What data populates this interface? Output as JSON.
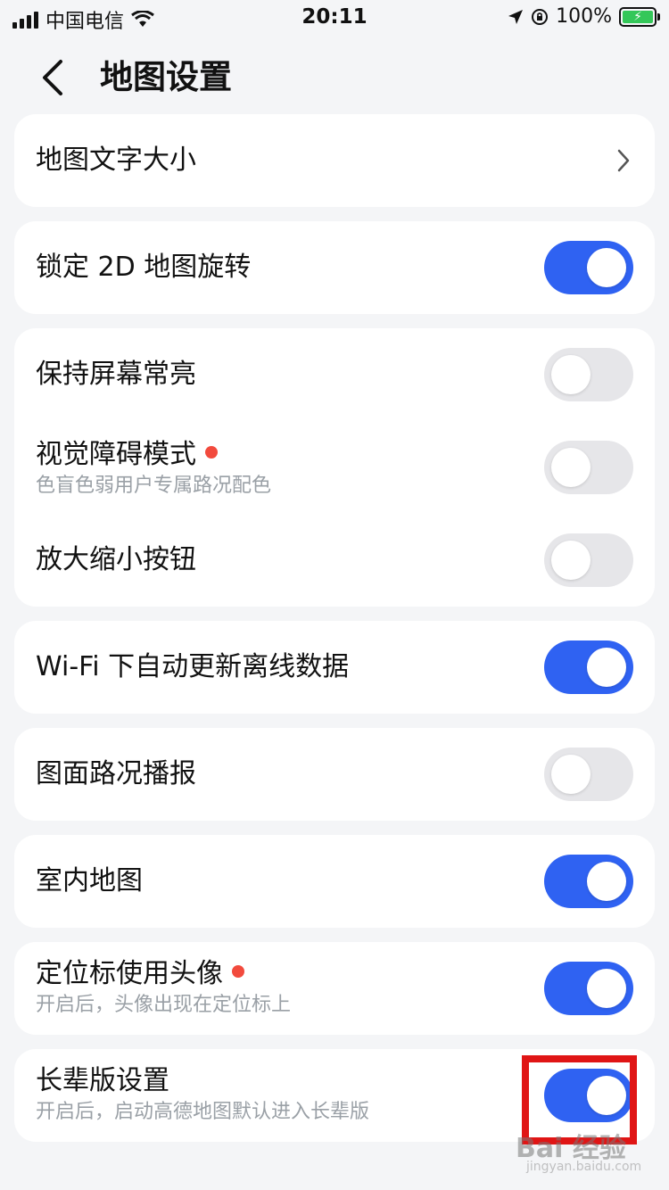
{
  "status_bar": {
    "carrier": "中国电信",
    "time": "20:11",
    "battery": "100%"
  },
  "header": {
    "title": "地图设置"
  },
  "settings": [
    {
      "label": "地图文字大小"
    },
    {
      "label": "锁定 2D 地图旋转",
      "on": true
    },
    {
      "label": "保持屏幕常亮",
      "on": false
    },
    {
      "label": "视觉障碍模式",
      "sub": "色盲色弱用户专属路况配色",
      "on": false,
      "dot": true
    },
    {
      "label": "放大缩小按钮",
      "on": false
    },
    {
      "label": "Wi-Fi 下自动更新离线数据",
      "on": true
    },
    {
      "label": "图面路况播报",
      "on": false
    },
    {
      "label": "室内地图",
      "on": true
    },
    {
      "label": "定位标使用头像",
      "sub": "开启后，头像出现在定位标上",
      "on": true,
      "dot": true
    },
    {
      "label": "长辈版设置",
      "sub": "开启后，启动高德地图默认进入长辈版",
      "on": true
    }
  ],
  "colors": {
    "accent": "#2f62f2",
    "toggle_off": "#e6e6e9",
    "badge_dot": "#f24a3d",
    "highlight": "#e01515"
  },
  "watermark": {
    "text": "Bai 经验",
    "sub": "jingyan.baidu.com"
  }
}
